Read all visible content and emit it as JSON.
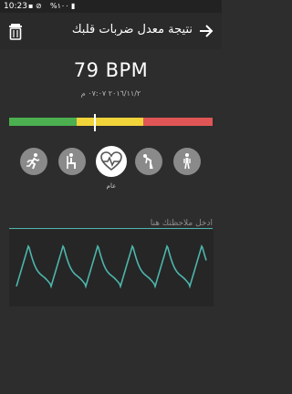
{
  "status_bar": {
    "time": "10:23",
    "icons_text": "▪ ⊘",
    "battery_text": "%١٠٠ ▮"
  },
  "header": {
    "title": "نتيجة معدل ضربات قلبك",
    "left_icon": "trash-icon",
    "right_icon": "arrow-forward-icon"
  },
  "result": {
    "bpm": "79 BPM",
    "datetime": "٢٠١٦/١١/٢ ٠٧:٠٧ م"
  },
  "range_bar": {
    "colors": [
      "#4caf50",
      "#f0d43a",
      "#e05555"
    ],
    "fractions": [
      0.33,
      0.33,
      0.34
    ],
    "marker_position": 0.42
  },
  "activities": {
    "items": [
      {
        "icon": "running-icon"
      },
      {
        "icon": "sitting-icon"
      },
      {
        "icon": "heart-pulse-icon"
      },
      {
        "icon": "bending-icon"
      },
      {
        "icon": "standing-icon"
      }
    ],
    "selected_index": 2,
    "selected_label": "عام"
  },
  "note": {
    "placeholder": "ادخل ملاحظتك هنا"
  },
  "waveform": {
    "color": "#4db6ac"
  }
}
